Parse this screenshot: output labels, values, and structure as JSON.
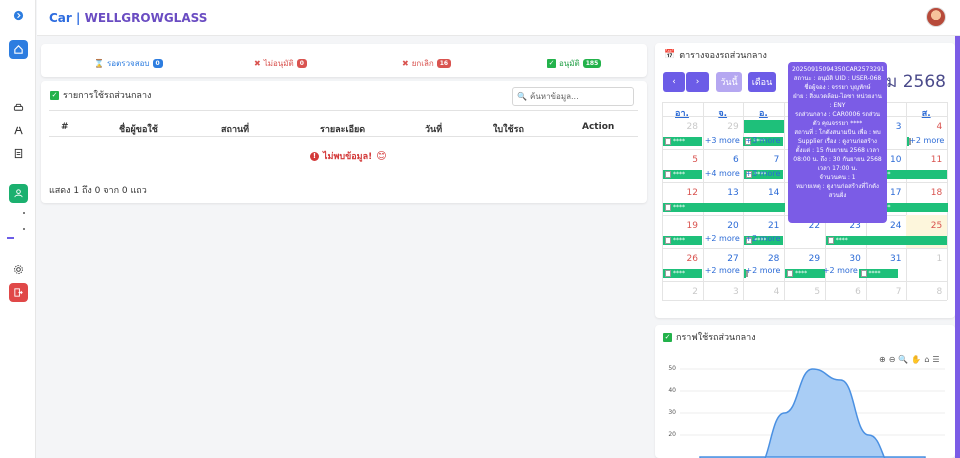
{
  "header": {
    "brand_prefix": "Car |",
    "brand_name": "WELLGROWGLASS"
  },
  "stats": [
    {
      "label": "รอตรวจสอบ",
      "count": "0",
      "color": "#2d7de0"
    },
    {
      "label": "ไม่อนุมัติ",
      "count": "0",
      "color": "#d9534f"
    },
    {
      "label": "ยกเลิก",
      "count": "16",
      "color": "#d9534f"
    },
    {
      "label": "อนุมัติ",
      "count": "185",
      "color": "#23b24b"
    }
  ],
  "list": {
    "title": "รายการใช้รถส่วนกลาง",
    "search_placeholder": "ค้นหาข้อมูล...",
    "columns": [
      "#",
      "ชื่อผู้ขอใช้",
      "สถานที่",
      "รายละเอียด",
      "วันที่",
      "ใบใช้รถ",
      "Action"
    ],
    "no_data": "ไม่พบข้อมูล!",
    "footer": "แสดง 1 ถึง 0 จาก 0 แถว"
  },
  "calendar": {
    "title": "ตารางจองรถส่วนกลาง",
    "prev": "‹",
    "next": "›",
    "day_btn": "วันนี้",
    "month_btn": "เดือน",
    "month_label": "คม 2568",
    "dow": [
      "อา.",
      "จ.",
      "อ.",
      "",
      "",
      "",
      "ส."
    ],
    "weeks": [
      [
        "28",
        "29",
        "",
        "",
        "",
        "3",
        "4"
      ],
      [
        "5",
        "6",
        "7",
        "",
        "",
        "10",
        "11"
      ],
      [
        "12",
        "13",
        "14",
        "",
        "",
        "17",
        "18"
      ],
      [
        "19",
        "20",
        "21",
        "22",
        "23",
        "24",
        "25"
      ],
      [
        "26",
        "27",
        "28",
        "29",
        "30",
        "31",
        "1"
      ],
      [
        "2",
        "3",
        "4",
        "5",
        "6",
        "7",
        "8"
      ]
    ],
    "event_text": "****",
    "more": "+3 more",
    "more4": "+4 more",
    "more2": "+2 more"
  },
  "tooltip": {
    "lines": [
      "20250915094350CAR2573291",
      "สถานะ : อนุมัติ  UID : USER-068 ชื่อผู้จอง : จรรยา บุญทักษ์",
      "ฝ่าย : สิ่งแวดล้อม-ไอซา หน่วยงาน : ENY",
      "รถส่วนกลาง : CAR0006 รถส่วนตัว คุณจรรยา ****",
      "สถานที่ : โกดังสนามบิน เพื่อ : พบ Supplier เรื่อง : ดูงานก่อสร้าง",
      "ตั้งแต่ : 15 กันยายน 2568 เวลา 08:00 น. ถึง : 30 กันยายน 2568 เวลา 17:00 น.",
      "จำนวนคน : 1",
      "หมายเหตุ : ดูงานก่อสร้างที่โกดังสวนฝั่ง"
    ]
  },
  "chart": {
    "title": "กราฟใช้รถส่วนกลาง",
    "chart_data": {
      "type": "area",
      "x": [
        0,
        1,
        2,
        3,
        4,
        5,
        6,
        7,
        8
      ],
      "values": [
        0,
        0,
        5,
        30,
        50,
        45,
        20,
        3,
        0
      ],
      "yticks": [
        "50",
        "40",
        "30",
        "20"
      ],
      "ylim": [
        10,
        50
      ],
      "color": "#4a90e2"
    }
  }
}
